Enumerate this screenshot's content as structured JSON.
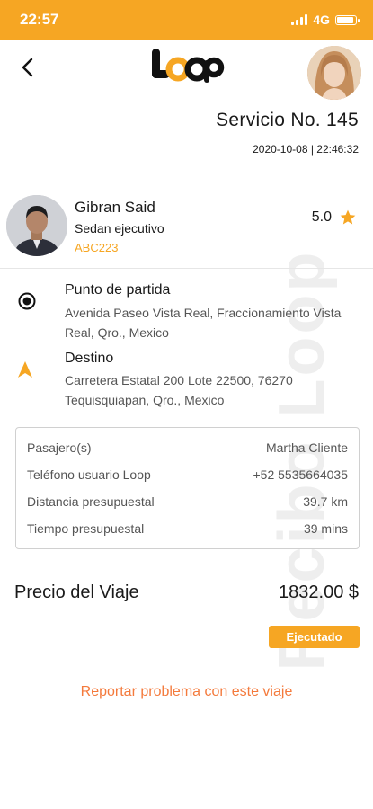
{
  "status_bar": {
    "time": "22:57",
    "network": "4G"
  },
  "header": {
    "back_icon": "chevron-left-icon",
    "logo_text": "loop"
  },
  "service": {
    "title": "Servicio No. 145",
    "datetime": "2020-10-08 | 22:46:32"
  },
  "watermark": "Recibo Loop",
  "driver": {
    "name": "Gibran Said",
    "vehicle": "Sedan ejecutivo",
    "plate": "ABC223",
    "rating": "5.0"
  },
  "route": {
    "origin": {
      "title": "Punto de partida",
      "address": "Avenida Paseo Vista Real, Fraccionamiento Vista Real, Qro., Mexico"
    },
    "destination": {
      "title": "Destino",
      "address": "Carretera Estatal 200 Lote 22500, 76270 Tequisquiapan, Qro., Mexico"
    }
  },
  "details": [
    {
      "label": "Pasajero(s)",
      "value": "Martha Cliente"
    },
    {
      "label": "Teléfono usuario Loop",
      "value": "+52 5535664035"
    },
    {
      "label": "Distancia presupuestal",
      "value": "39.7 km"
    },
    {
      "label": "Tiempo presupuestal",
      "value": "39 mins"
    }
  ],
  "price": {
    "label": "Precio del Viaje",
    "value": "1832.00 $"
  },
  "status": {
    "label": "Ejecutado"
  },
  "report": {
    "label": "Reportar problema con este viaje"
  },
  "colors": {
    "accent": "#f6a623",
    "link": "#f47a3c"
  }
}
